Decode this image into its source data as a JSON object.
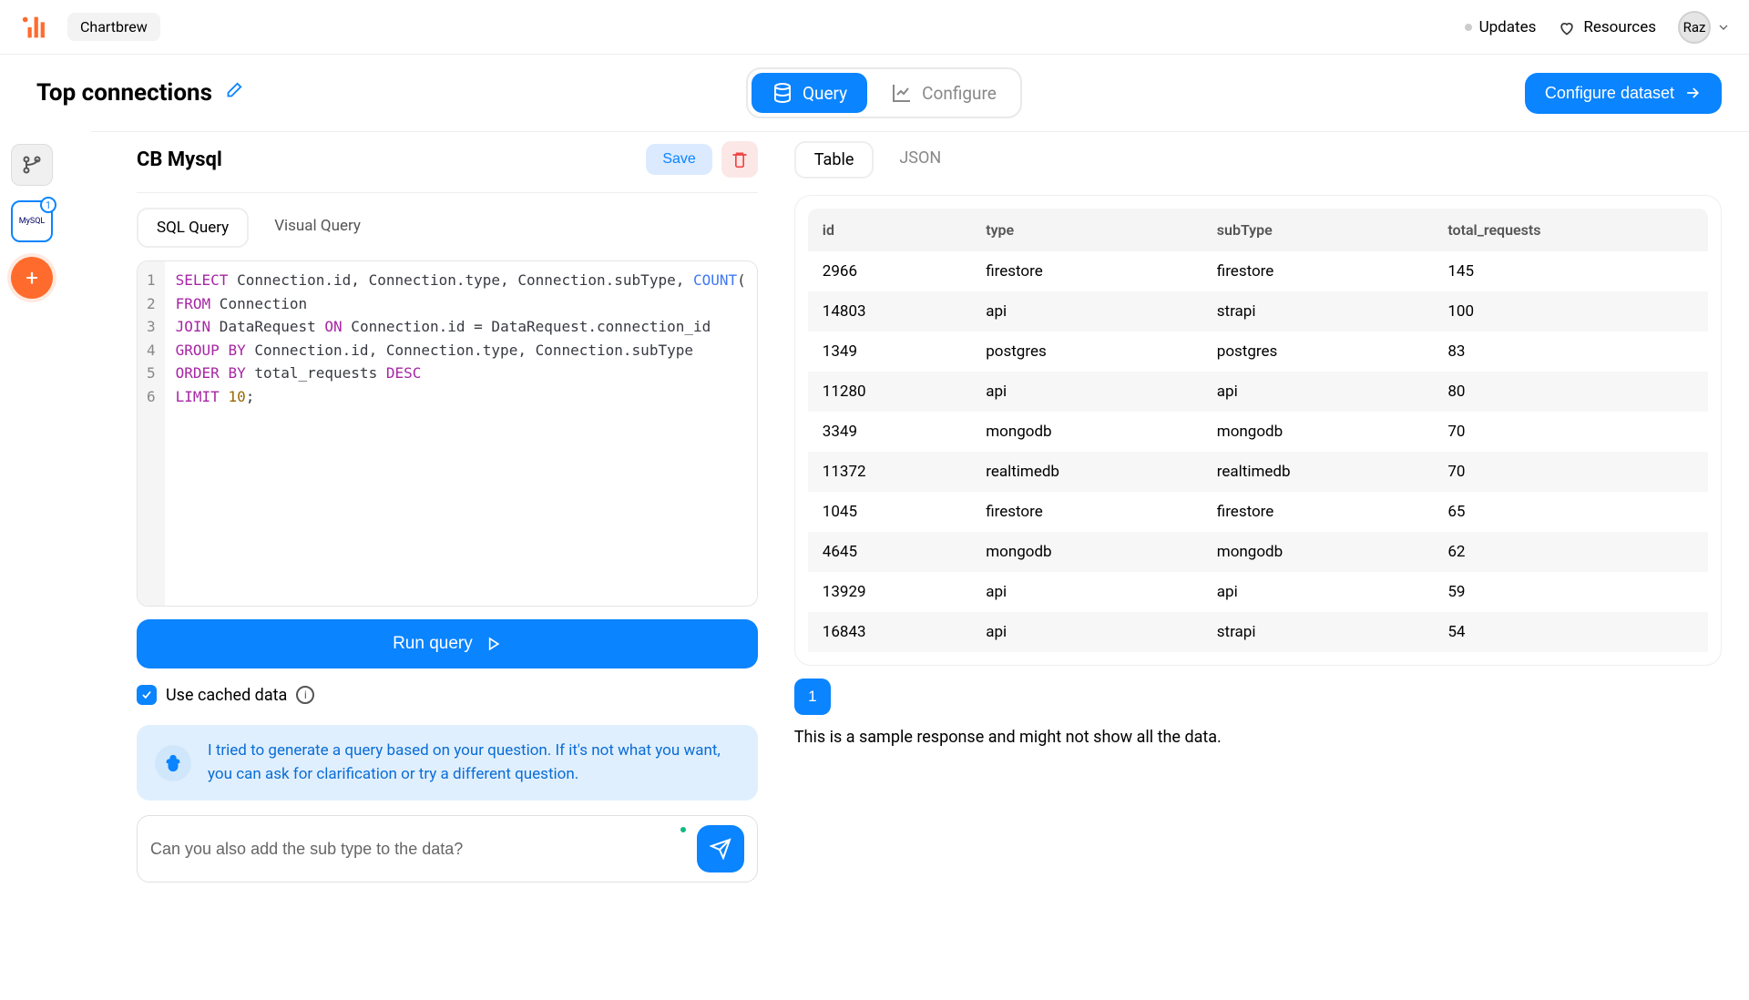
{
  "topbar": {
    "app_name": "Chartbrew",
    "updates": "Updates",
    "resources": "Resources",
    "user_initials": "Raz"
  },
  "secondbar": {
    "page_title": "Top connections",
    "query_tab": "Query",
    "configure_tab": "Configure",
    "configure_dataset_btn": "Configure dataset"
  },
  "sidebar": {
    "mysql_badge": "1",
    "mysql_label": "MySQL"
  },
  "left": {
    "panel_title": "CB Mysql",
    "save_label": "Save",
    "tab_sql": "SQL Query",
    "tab_visual": "Visual Query",
    "code_lines": [
      "1",
      "2",
      "3",
      "4",
      "5",
      "6"
    ],
    "run_label": "Run query",
    "cache_label": "Use cached data",
    "ai_note": "I tried to generate a query based on your question. If it's not what you want, you can ask for clarification or try a different question.",
    "prompt_value": "Can you also add the sub type to the data?"
  },
  "sql": {
    "line1_select": "SELECT",
    "line1_part1": " Connection.id, Connection.type, Connection.subType, ",
    "line1_count": "COUNT",
    "line1_part2": "(",
    "line2_from": "FROM",
    "line2_rest": " Connection",
    "line3_join": "JOIN",
    "line3_mid": " DataRequest ",
    "line3_on": "ON",
    "line3_rest": " Connection.id = DataRequest.connection_id",
    "line4_group": "GROUP BY",
    "line4_rest": " Connection.id, Connection.type, Connection.subType",
    "line5_order": "ORDER BY",
    "line5_mid": " total_requests ",
    "line5_desc": "DESC",
    "line6_limit": "LIMIT ",
    "line6_num": "10",
    "line6_end": ";"
  },
  "right": {
    "tab_table": "Table",
    "tab_json": "JSON",
    "columns": [
      "id",
      "type",
      "subType",
      "total_requests"
    ],
    "rows": [
      {
        "id": "2966",
        "type": "firestore",
        "subType": "firestore",
        "total_requests": "145"
      },
      {
        "id": "14803",
        "type": "api",
        "subType": "strapi",
        "total_requests": "100"
      },
      {
        "id": "1349",
        "type": "postgres",
        "subType": "postgres",
        "total_requests": "83"
      },
      {
        "id": "11280",
        "type": "api",
        "subType": "api",
        "total_requests": "80"
      },
      {
        "id": "3349",
        "type": "mongodb",
        "subType": "mongodb",
        "total_requests": "70"
      },
      {
        "id": "11372",
        "type": "realtimedb",
        "subType": "realtimedb",
        "total_requests": "70"
      },
      {
        "id": "1045",
        "type": "firestore",
        "subType": "firestore",
        "total_requests": "65"
      },
      {
        "id": "4645",
        "type": "mongodb",
        "subType": "mongodb",
        "total_requests": "62"
      },
      {
        "id": "13929",
        "type": "api",
        "subType": "api",
        "total_requests": "59"
      },
      {
        "id": "16843",
        "type": "api",
        "subType": "strapi",
        "total_requests": "54"
      }
    ],
    "page_1": "1",
    "sample_note": "This is a sample response and might not show all the data."
  }
}
